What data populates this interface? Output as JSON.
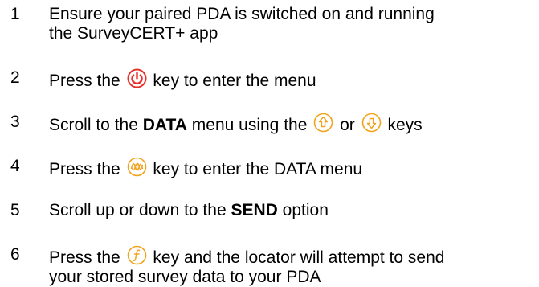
{
  "steps": [
    {
      "number": "1",
      "line1": "Ensure your paired PDA is switched on and running",
      "line2": "the SurveyCERT+ app"
    },
    {
      "number": "2",
      "before": "Press the",
      "after": "key to enter the menu",
      "icon": "power-key-icon"
    },
    {
      "number": "3",
      "before": "Scroll to the",
      "bold": "DATA",
      "middle": "menu using the",
      "conj": "or",
      "after": "keys",
      "icons": [
        "up-arrow-key-icon",
        "down-arrow-key-icon"
      ]
    },
    {
      "number": "4",
      "before": "Press the",
      "after": "key to enter the DATA menu",
      "icon": "mode-key-icon"
    },
    {
      "number": "5",
      "before": "Scroll up or down to the",
      "bold": "SEND",
      "after": "option"
    },
    {
      "number": "6",
      "before": "Press the",
      "after": "key and the locator will attempt to send",
      "line2": "your stored survey data to your PDA",
      "icon": "function-key-icon"
    }
  ],
  "colors": {
    "text": "#000000",
    "power_icon": "#e8302a",
    "nav_icon": "#f2a21b"
  }
}
